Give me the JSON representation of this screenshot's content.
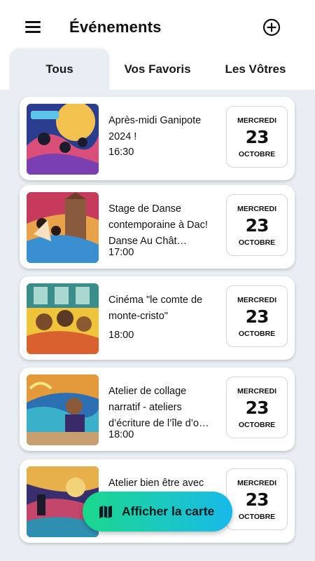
{
  "header": {
    "title": "Événements",
    "menu_icon": "menu-icon",
    "add_icon": "add-circle-icon"
  },
  "tabs": [
    {
      "label": "Tous",
      "selected": true
    },
    {
      "label": "Vos Favoris",
      "selected": false
    },
    {
      "label": "Les Vôtres",
      "selected": false
    }
  ],
  "events": [
    {
      "title": "Après-midi Ganipote 2024 !",
      "time": "16:30",
      "weekday": "MERCREDI",
      "day": "23",
      "month": "OCTOBRE"
    },
    {
      "title": "Stage de Danse contemporaine à Dac! Danse Au Chât…",
      "time": "17:00",
      "weekday": "MERCREDI",
      "day": "23",
      "month": "OCTOBRE"
    },
    {
      "title": "Cinéma \"le comte de monte-cristo\"",
      "time": "18:00",
      "weekday": "MERCREDI",
      "day": "23",
      "month": "OCTOBRE"
    },
    {
      "title": "Atelier de collage narratif - ateliers d’écriture de l’île d’o…",
      "time": "18:00",
      "weekday": "MERCREDI",
      "day": "23",
      "month": "OCTOBRE"
    },
    {
      "title": "Atelier bien être avec",
      "time": "",
      "weekday": "MERCREDI",
      "day": "23",
      "month": "OCTOBRE"
    }
  ],
  "fab": {
    "label": "Afficher la carte",
    "icon": "map-icon"
  },
  "colors": {
    "list_background": "#e8eef3",
    "fab_gradient_start": "#19d88a",
    "fab_gradient_end": "#18b9e8"
  }
}
